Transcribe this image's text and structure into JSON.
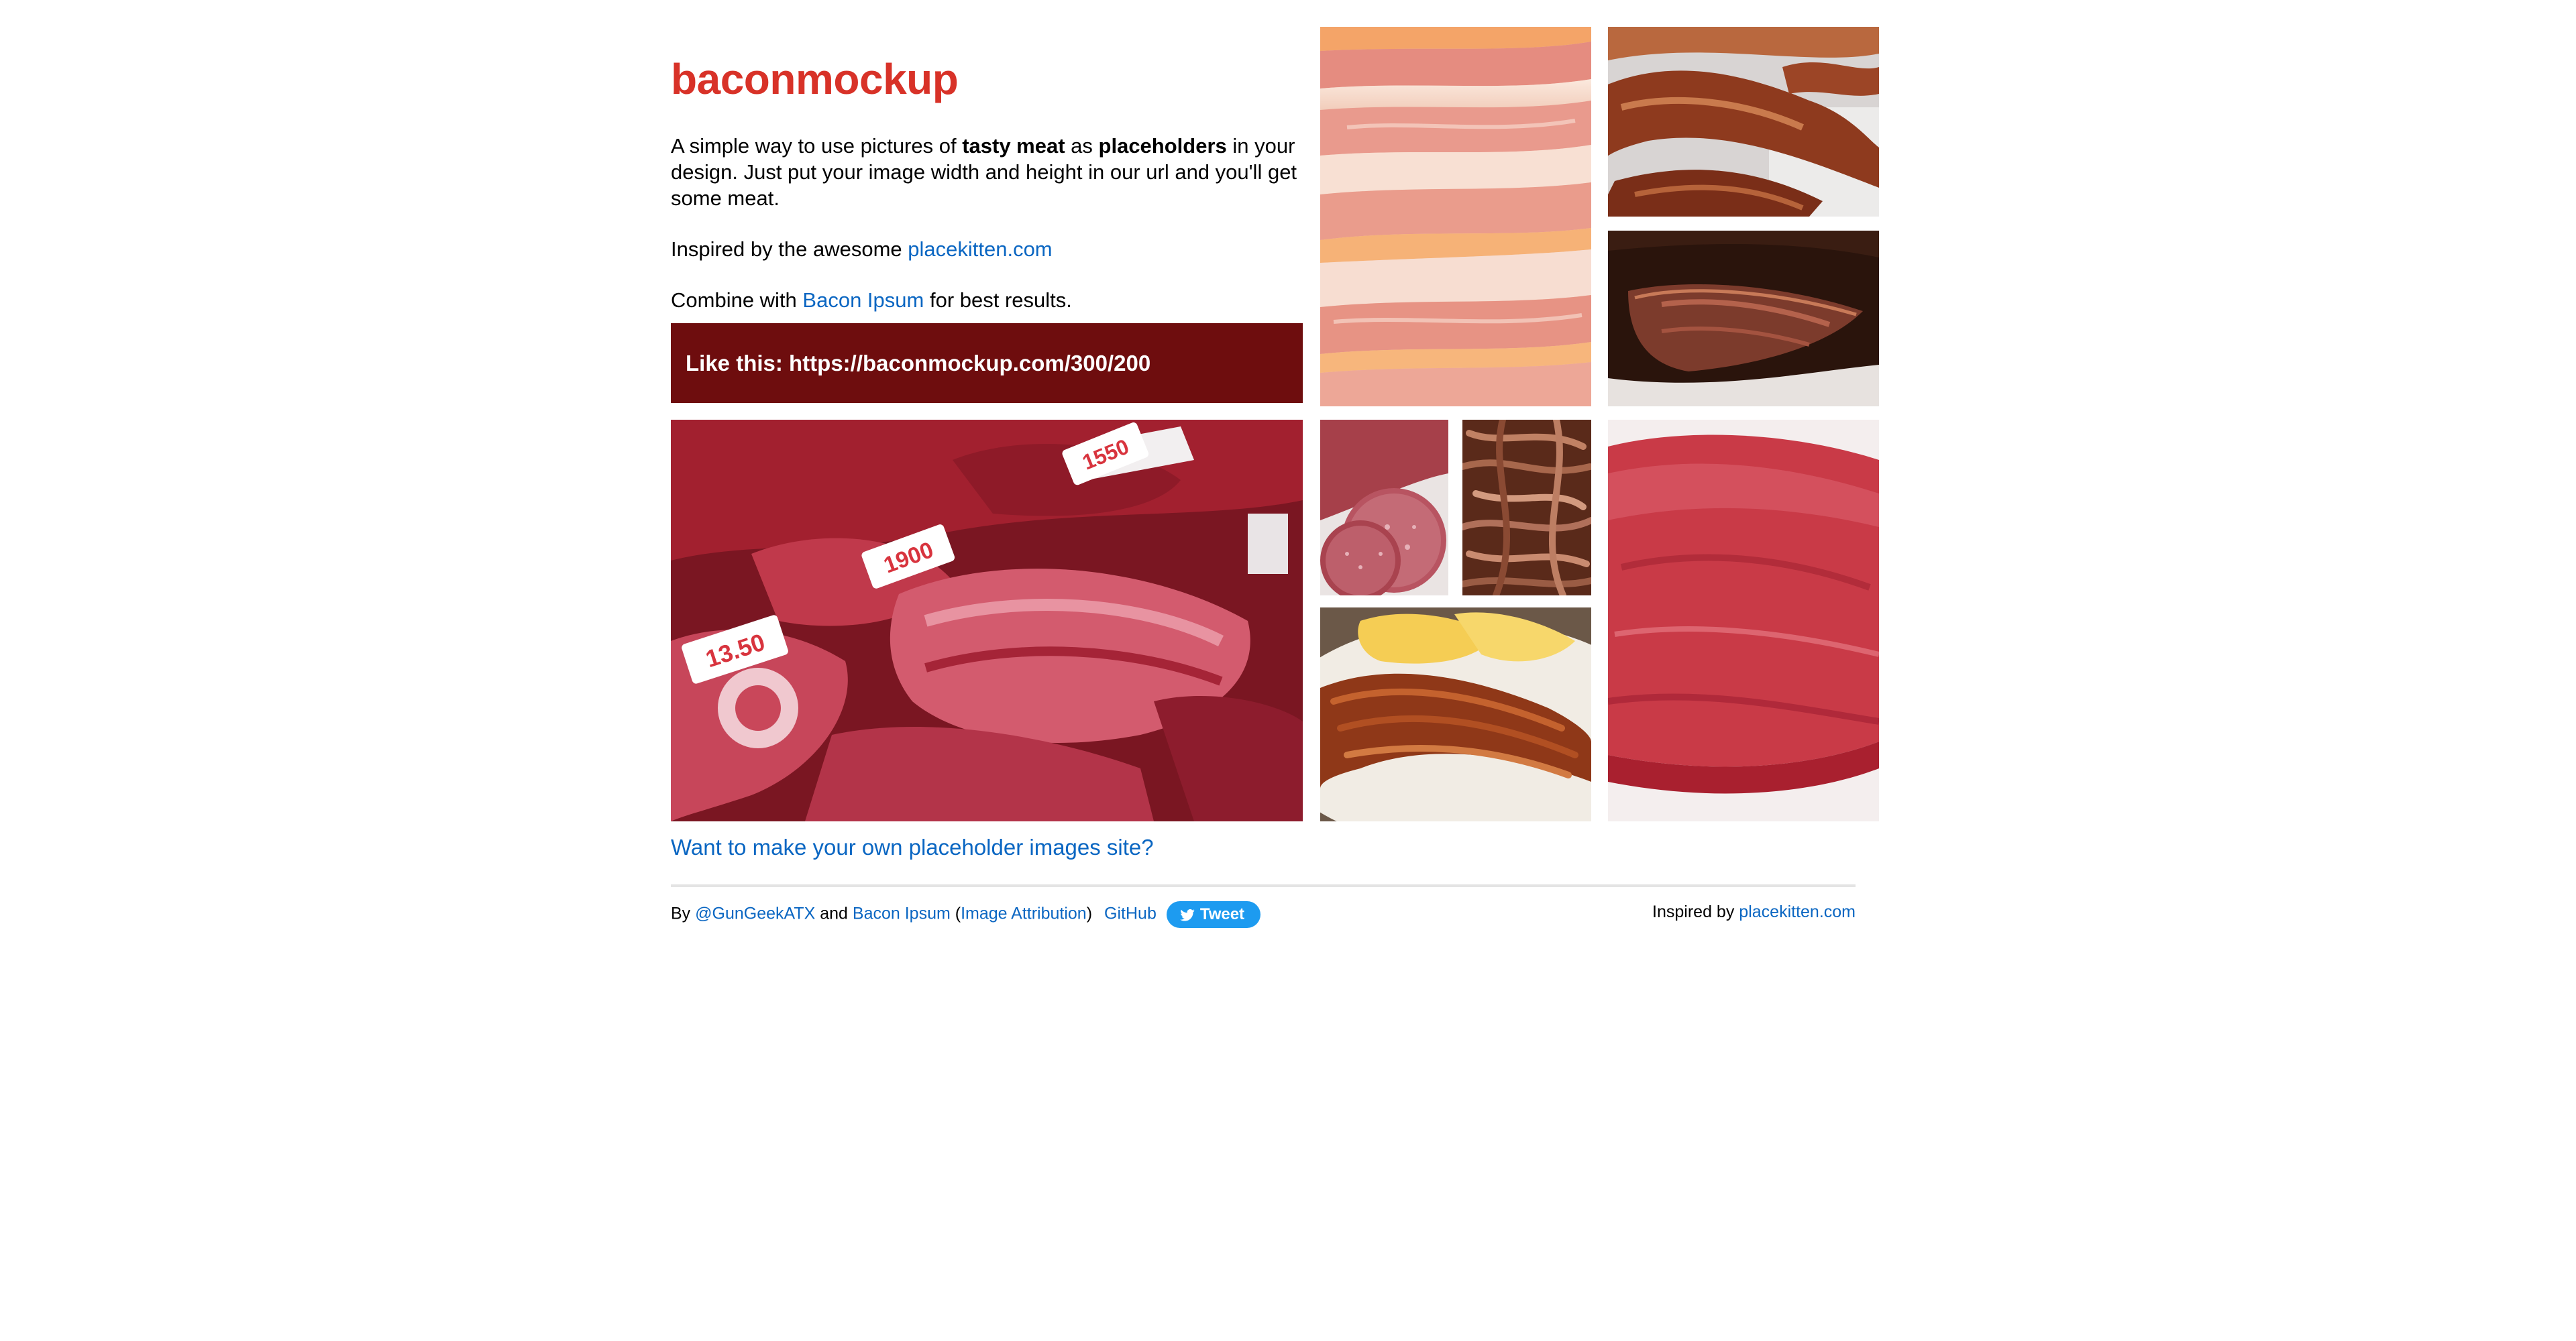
{
  "header": {
    "title": "baconmockup"
  },
  "intro": {
    "p1_a": "A simple way to use pictures of ",
    "p1_b": "tasty meat",
    "p1_c": " as ",
    "p1_d": "placeholders",
    "p1_e": " in your design. Just put your image width and height in our url and you'll get some meat.",
    "p2_a": "Inspired by the awesome ",
    "p2_link": "placekitten.com",
    "p3_a": "Combine with ",
    "p3_link": "Bacon Ipsum",
    "p3_b": " for best results."
  },
  "example": {
    "text": "Like this: https://baconmockup.com/300/200"
  },
  "more_link": "Want to make your own placeholder images site?",
  "footer": {
    "by": "By ",
    "author_link": "@GunGeekATX",
    "and": " and ",
    "bacon_ipsum_link": "Bacon Ipsum",
    "paren_open": " (",
    "attribution_link": "Image Attribution",
    "paren_close": ")",
    "github_link": "GitHub",
    "tweet_label": "Tweet",
    "inspired_by": "Inspired by ",
    "placekitten_link": "placekitten.com"
  },
  "colors": {
    "title_red": "#d83228",
    "example_bg": "#6e0d0e",
    "link_blue": "#0a66c2",
    "tweet_blue": "#1d9bf0"
  }
}
